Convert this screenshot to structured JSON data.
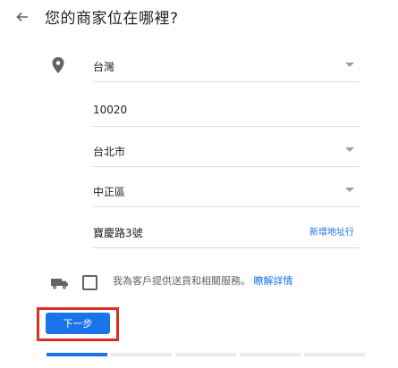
{
  "header": {
    "title": "您的商家位在哪裡?"
  },
  "form": {
    "country": {
      "value": "台灣"
    },
    "postal_code": {
      "value": "10020"
    },
    "city": {
      "value": "台北市"
    },
    "district": {
      "value": "中正區"
    },
    "address": {
      "value": "寶慶路3號",
      "add_line_label": "新增地址行"
    }
  },
  "delivery": {
    "text": "我為客戶提供送貨和相關服務。",
    "learn_more": "瞭解詳情",
    "checked": false
  },
  "actions": {
    "next_label": "下一步"
  },
  "progress": {
    "current_step": 1,
    "total_steps": 5
  },
  "colors": {
    "accent": "#1a73e8",
    "highlight": "#d93025",
    "icon": "#5f6368"
  },
  "icons": [
    "back-arrow-icon",
    "location-pin-icon",
    "truck-icon",
    "dropdown-caret-icon"
  ]
}
